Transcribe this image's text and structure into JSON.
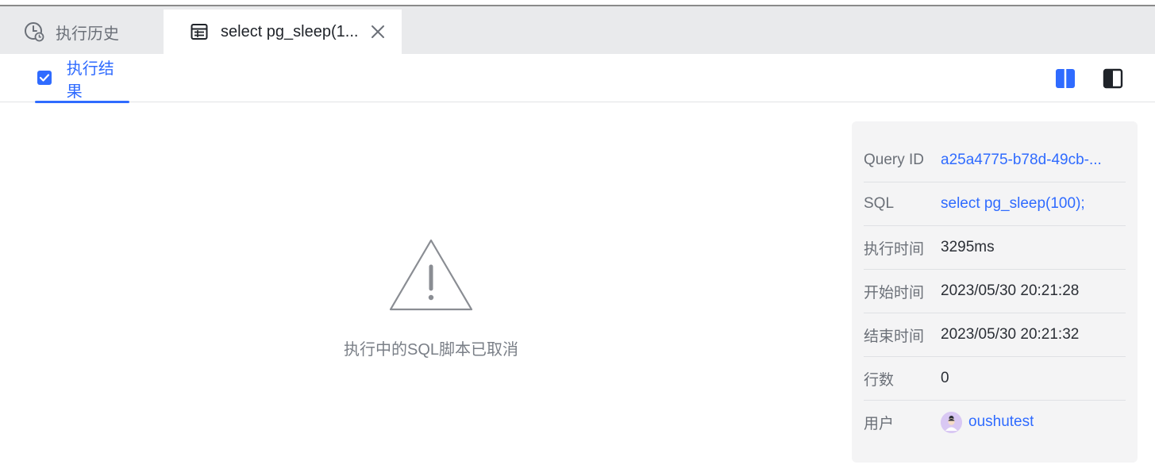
{
  "tabs": [
    {
      "label": "执行历史",
      "icon": "clock-history-icon",
      "active": false
    },
    {
      "label": "select pg_sleep(1...",
      "icon": "table-icon",
      "active": true
    }
  ],
  "subtabs": [
    {
      "label": "执行结果",
      "icon": "checkbox-icon",
      "active": true
    }
  ],
  "layout_buttons": [
    {
      "icon": "split-layout-icon",
      "active": true
    },
    {
      "icon": "side-panel-layout-icon",
      "active": false
    }
  ],
  "empty_state": {
    "icon": "warning-triangle-icon",
    "message": "执行中的SQL脚本已取消"
  },
  "info_panel": {
    "rows": [
      {
        "label": "Query ID",
        "value": "a25a4775-b78d-49cb-..."
      },
      {
        "label": "SQL",
        "value": "select pg_sleep(100);"
      },
      {
        "label": "执行时间",
        "value": "3295ms"
      },
      {
        "label": "开始时间",
        "value": "2023/05/30 20:21:28"
      },
      {
        "label": "结束时间",
        "value": "2023/05/30 20:21:32"
      },
      {
        "label": "行数",
        "value": "0"
      },
      {
        "label": "用户",
        "value": "oushutest"
      }
    ]
  },
  "colors": {
    "accent": "#2f6bff",
    "tabbar_bg": "#e9eaec",
    "panel_bg": "#f4f4f5",
    "muted_text": "#7a7f87"
  }
}
